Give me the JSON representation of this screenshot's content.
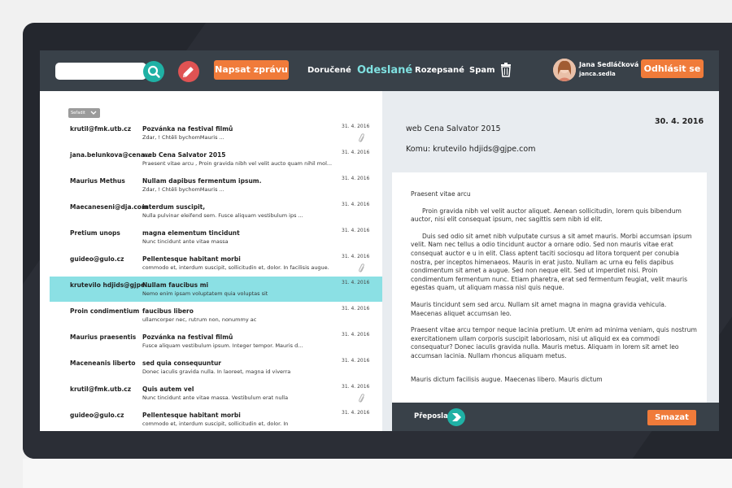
{
  "toolbar": {
    "search_placeholder": "",
    "compose_label": "Napsat zprávu",
    "nav": [
      "Doručené",
      "Odeslané",
      "Rozepsané",
      "Spam"
    ],
    "active_nav": "Odeslané"
  },
  "user": {
    "name": "Jana Sedláčková",
    "handle": "janca.sedla",
    "logout_label": "Odhlásit se"
  },
  "list": {
    "sort_label": "Seřadit",
    "rows": [
      {
        "sender": "krutil@fmk.utb.cz",
        "subject": "Pozvánka na festival filmů",
        "preview": "Zdar, ! Chtěli bychomMauris  ...",
        "date": "31. 4. 2016",
        "attachment": true,
        "selected": false
      },
      {
        "sender": "jana.belunkova@cena...",
        "subject": "web Cena Salvator 2015",
        "preview": "Praesent vitae arcu , Proin gravida nibh vel velit aucto quam nihil mol...",
        "date": "31. 4. 2016",
        "attachment": false,
        "selected": false
      },
      {
        "sender": "Maurius Methus",
        "subject": "Nullam dapibus fermentum ipsum.",
        "preview": "Zdar, ! Chtěli bychomMauris  ...",
        "date": "31. 4. 2016",
        "attachment": false,
        "selected": false
      },
      {
        "sender": "Maecaneseni@dja.com",
        "subject": "interdum suscipit,",
        "preview": "Nulla pulvinar eleifend sem. Fusce aliquam vestibulum ips ...",
        "date": "31. 4. 2016",
        "attachment": false,
        "selected": false
      },
      {
        "sender": "Pretium unops",
        "subject": "magna elementum tincidunt",
        "preview": "Nunc tincidunt ante vitae massa",
        "date": "31. 4. 2016",
        "attachment": false,
        "selected": false
      },
      {
        "sender": "guideo@gulo.cz",
        "subject": "Pellentesque habitant morbi",
        "preview": "commodo et, interdum suscipit, sollicitudin et, dolor. In facilisis augue.",
        "date": "31. 4. 2016",
        "attachment": true,
        "selected": false
      },
      {
        "sender": "krutevilo hdjids@gjpe....",
        "subject": "Nullam faucibus mi",
        "preview": "Nemo enim ipsam voluptatem quia voluptas sit",
        "date": "31. 4. 2016",
        "attachment": false,
        "selected": true
      },
      {
        "sender": "Proin condimentium",
        "subject": "faucibus libero",
        "preview": "ullamcorper nec, rutrum non, nonummy ac",
        "date": "31. 4. 2016",
        "attachment": false,
        "selected": false
      },
      {
        "sender": "Maurius praesentis",
        "subject": "Pozvánka na festival filmů",
        "preview": "Fusce aliquam vestibulum ipsum. Integer tempor. Mauris d...",
        "date": "31. 4. 2016",
        "attachment": false,
        "selected": false
      },
      {
        "sender": "Maceneanis liberto",
        "subject": "sed quia consequuntur",
        "preview": "Donec iaculis gravida nulla. In laoreet, magna id viverra",
        "date": "31. 4. 2016",
        "attachment": false,
        "selected": false
      },
      {
        "sender": "krutil@fmk.utb.cz",
        "subject": "Quis autem vel",
        "preview": "Nunc tincidunt ante vitae massa. Vestibulum erat nulla",
        "date": "31. 4. 2016",
        "attachment": true,
        "selected": false
      },
      {
        "sender": "guideo@gulo.cz",
        "subject": "Pellentesque habitant morbi",
        "preview": "commodo et, interdum suscipit, sollicitudin et, dolor. In",
        "date": "31. 4. 2016",
        "attachment": false,
        "selected": false
      }
    ]
  },
  "reader": {
    "date": "30. 4. 2016",
    "title": "web Cena Salvator 2015",
    "to": "Komu: krutevilo hdjids@gjpe.com",
    "paragraphs": [
      "Praesent vitae arcu",
      "Proin gravida nibh vel velit auctor aliquet. Aenean sollicitudin, lorem quis bibendum auctor, nisi elit consequat ipsum, nec sagittis sem nibh id elit.",
      "Duis sed odio sit amet nibh vulputate cursus a sit amet mauris. Morbi accumsan ipsum velit. Nam nec tellus a odio tincidunt auctor a ornare odio. Sed non  mauris vitae erat consequat auctor e u in elit. Class aptent taciti sociosqu ad litora torquent per conubia nostra, per inceptos himenaeos. Mauris in erat justo. Nullam ac urna eu felis dapibus condimentum sit amet a augue. Sed non neque elit. Sed ut imperdiet nisi. Proin condimentum fermentum nunc. Etiam pharetra, erat sed fermentum feugiat, velit mauris egestas quam, ut aliquam massa nisl quis neque.",
      "Mauris tincidunt sem sed arcu. Nullam sit amet magna in magna gravida vehicula. Maecenas aliquet accumsan leo.",
      "Praesent vitae arcu tempor neque lacinia pretium. Ut enim ad minima veniam, quis nostrum exercitationem ullam corporis suscipit laboriosam, nisi ut aliquid ex ea commodi consequatur? Donec iaculis gravida nulla. Mauris metus. Aliquam in lorem sit amet leo accumsan lacinia. Nullam rhoncus aliquam metus.",
      "Mauris dictum facilisis augue. Maecenas libero. Mauris dictum"
    ],
    "forward_label": "Přeposlat",
    "delete_label": "Smazat"
  },
  "colors": {
    "topbar": "#394149",
    "accent_orange": "#f07b3a",
    "teal": "#1fb1a5",
    "selected_row": "#8be0e4",
    "active_nav": "#7fe0e0"
  }
}
